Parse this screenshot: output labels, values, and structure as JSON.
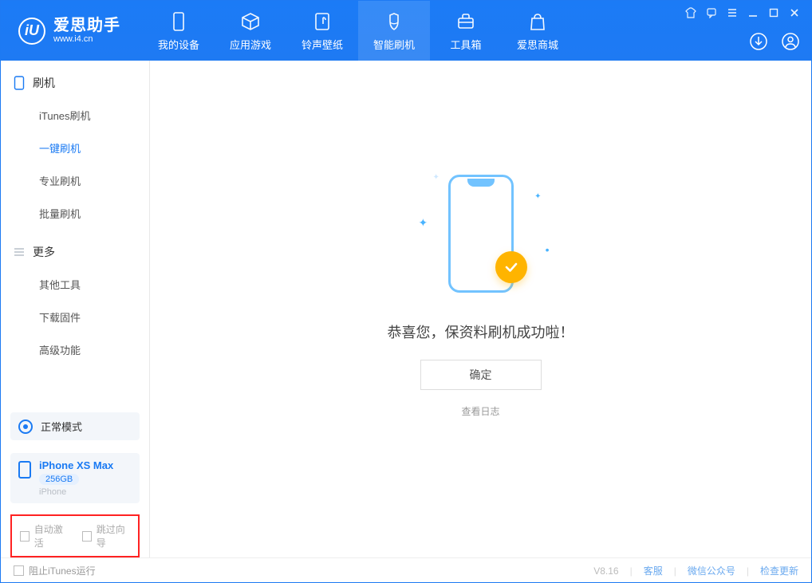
{
  "header": {
    "app_name": "爱思助手",
    "app_url": "www.i4.cn",
    "nav": [
      {
        "label": "我的设备",
        "icon": "device-icon"
      },
      {
        "label": "应用游戏",
        "icon": "cube-icon"
      },
      {
        "label": "铃声壁纸",
        "icon": "music-file-icon"
      },
      {
        "label": "智能刷机",
        "icon": "flash-icon",
        "active": true
      },
      {
        "label": "工具箱",
        "icon": "toolbox-icon"
      },
      {
        "label": "爱思商城",
        "icon": "shop-bag-icon"
      }
    ]
  },
  "sidebar": {
    "sections": [
      {
        "title": "刷机",
        "icon": "phone-icon",
        "items": [
          {
            "label": "iTunes刷机"
          },
          {
            "label": "一键刷机",
            "active": true
          },
          {
            "label": "专业刷机"
          },
          {
            "label": "批量刷机"
          }
        ]
      },
      {
        "title": "更多",
        "icon": "menu-icon",
        "items": [
          {
            "label": "其他工具"
          },
          {
            "label": "下载固件"
          },
          {
            "label": "高级功能"
          }
        ]
      }
    ],
    "mode_label": "正常模式",
    "device": {
      "name": "iPhone XS Max",
      "capacity": "256GB",
      "type": "iPhone"
    },
    "options": {
      "auto_activate": "自动激活",
      "skip_guide": "跳过向导"
    }
  },
  "content": {
    "success_message": "恭喜您，保资料刷机成功啦！",
    "confirm_label": "确定",
    "log_link": "查看日志"
  },
  "footer": {
    "block_itunes": "阻止iTunes运行",
    "version": "V8.16",
    "links": {
      "cs": "客服",
      "wechat": "微信公众号",
      "update": "检查更新"
    }
  },
  "colors": {
    "accent": "#1a7af3",
    "highlight": "#ffb400"
  }
}
